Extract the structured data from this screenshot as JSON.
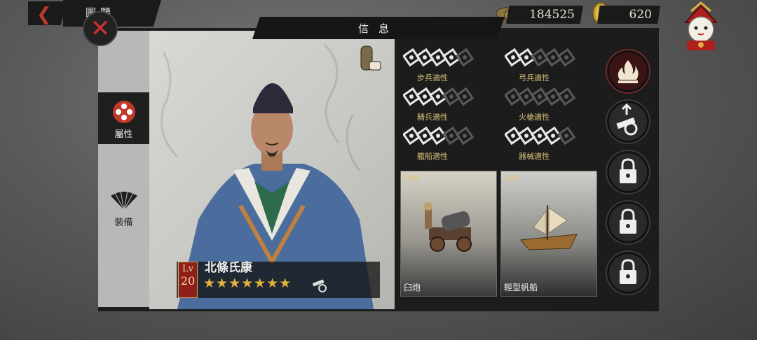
{
  "header": {
    "back_icon": "chevron-left-icon",
    "title": "圖鑒",
    "close_icon": "close-icon"
  },
  "resources": {
    "coins": "184525",
    "gold": "620"
  },
  "panel": {
    "title": "信息"
  },
  "tabs": [
    {
      "label": "屬性",
      "icon": "crest-icon",
      "active": true
    },
    {
      "label": "裝備",
      "icon": "fan-icon",
      "active": false
    }
  ],
  "hero": {
    "name": "北條氏康",
    "level_prefix": "Lv",
    "level": "20",
    "stars": "★★★★★★★",
    "star_count": 7,
    "unit_icon": "cannon-icon"
  },
  "aptitudes": [
    {
      "label": "步兵適性",
      "icon": "sword-icon",
      "filled": 4,
      "total": 5
    },
    {
      "label": "弓兵適性",
      "icon": "bow-icon",
      "filled": 2,
      "total": 5
    },
    {
      "label": "騎兵適性",
      "icon": "horse-icon",
      "filled": 3,
      "total": 5
    },
    {
      "label": "火槍適性",
      "icon": "musket-icon",
      "filled": 0,
      "total": 5
    },
    {
      "label": "艦船適性",
      "icon": "anchor-icon",
      "filled": 3,
      "total": 5
    },
    {
      "label": "器械適性",
      "icon": "cannon-icon",
      "filled": 4,
      "total": 5
    }
  ],
  "units": [
    {
      "level": "Lv6",
      "name": "臼炮",
      "icon": "mortar-icon"
    },
    {
      "level": "Lv6",
      "name": "輕型帆船",
      "icon": "sailboat-icon"
    }
  ],
  "side_buttons": [
    {
      "icon": "fire-icon",
      "locked": false
    },
    {
      "icon": "cannon-upgrade-icon",
      "locked": false
    },
    {
      "icon": "lock-icon",
      "locked": true
    },
    {
      "icon": "lock-icon",
      "locked": true
    },
    {
      "icon": "lock-icon",
      "locked": true
    }
  ],
  "colors": {
    "accent_red": "#c0392b",
    "star_gold": "#e3b43a",
    "label_gold": "#d8c27a"
  }
}
